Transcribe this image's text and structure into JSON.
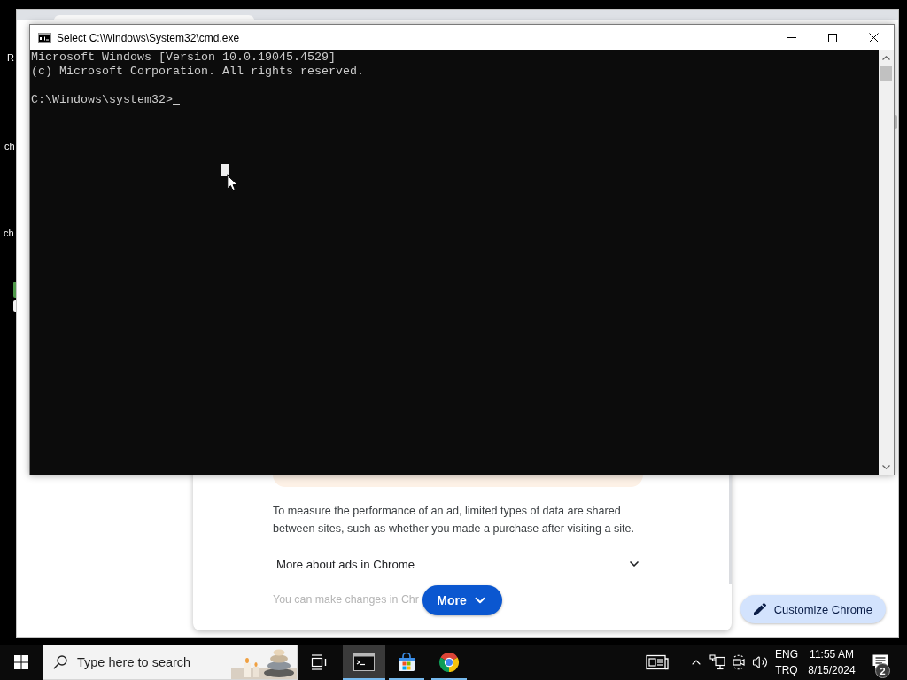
{
  "desktop": {
    "icon_labels": [
      "R",
      "ch",
      "ch"
    ]
  },
  "browser": {
    "dialog": {
      "paragraph": "To measure the performance of an ad, limited types of data are shared between sites, such as whether you made a purchase after visiting a site.",
      "expander": {
        "label": "More about ads in Chrome",
        "expanded": false
      },
      "faded_text": "You can make changes in Chr",
      "more_button": "More"
    },
    "customize_button": "Customize Chrome"
  },
  "console": {
    "title": "Select C:\\Windows\\System32\\cmd.exe",
    "lines": [
      "Microsoft Windows [Version 10.0.19045.4529]",
      "(c) Microsoft Corporation. All rights reserved."
    ],
    "prompt": "C:\\Windows\\system32>"
  },
  "taskbar": {
    "search": {
      "placeholder": "Type here to search"
    },
    "apps": [
      {
        "kind": "terminal",
        "active": true,
        "running": true
      },
      {
        "kind": "store",
        "active": false,
        "running": true
      },
      {
        "kind": "browser",
        "active": false,
        "running": true
      }
    ],
    "tray": {
      "language": "ENG",
      "layout": "TRQ",
      "time": "11:55 AM",
      "date": "8/15/2024",
      "notifications": "2"
    }
  }
}
